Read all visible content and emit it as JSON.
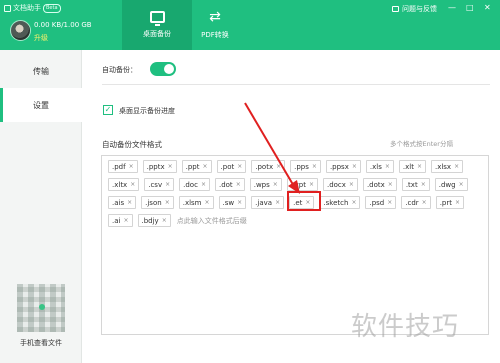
{
  "app": {
    "title": "文档助手",
    "badge": "Beta"
  },
  "user": {
    "storage": "0.00 KB/1.00 GB",
    "upgrade": "升级"
  },
  "tabs": [
    {
      "label": "桌面备份",
      "icon": "monitor-icon",
      "active": true
    },
    {
      "label": "PDF转换",
      "icon": "pdf-convert-icon",
      "active": false
    }
  ],
  "help": {
    "label": "问题与反馈"
  },
  "window": {
    "minimize": "—",
    "maximize": "□",
    "close": "✕"
  },
  "sidebar": {
    "items": [
      {
        "label": "传输"
      },
      {
        "label": "设置"
      }
    ],
    "mobile_label": "手机查看文件"
  },
  "settings": {
    "auto_backup_label": "自动备份：",
    "auto_backup_on": true,
    "show_progress_label": "桌面显示备份进度",
    "show_progress_checked": true,
    "format_section_title": "自动备份文件格式",
    "format_hint": "多个格式按Enter分隔",
    "formats": [
      ".pdf",
      ".pptx",
      ".ppt",
      ".pot",
      ".potx",
      ".pps",
      ".ppsx",
      ".xls",
      ".xlt",
      ".xlsx",
      ".xltx",
      ".csv",
      ".doc",
      ".dot",
      ".wps",
      ".wpt",
      ".docx",
      ".dotx",
      ".txt",
      ".dwg",
      ".ais",
      ".json",
      ".xlsm",
      ".sw",
      ".java",
      ".et",
      ".sketch",
      ".psd",
      ".cdr",
      ".prt",
      ".ai",
      ".bdjy"
    ],
    "input_placeholder": "点此输入文件格式后缀"
  },
  "colors": {
    "brand": "#1fbf80",
    "highlight": "#e02020"
  },
  "watermark": "软件技巧"
}
